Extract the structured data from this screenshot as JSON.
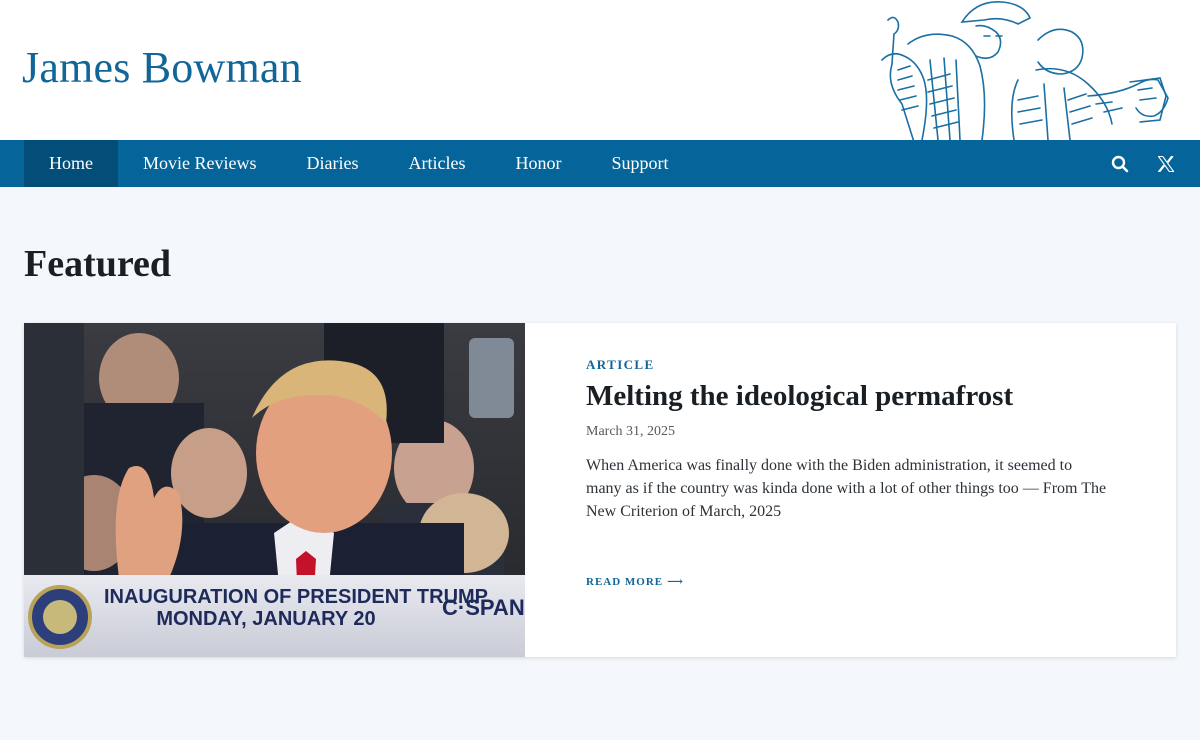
{
  "site": {
    "title": "James Bowman"
  },
  "nav": {
    "items": [
      {
        "label": "Home",
        "active": true
      },
      {
        "label": "Movie Reviews"
      },
      {
        "label": "Diaries"
      },
      {
        "label": "Articles"
      },
      {
        "label": "Honor"
      },
      {
        "label": "Support"
      }
    ],
    "icons": [
      "search-icon",
      "x-logo-icon"
    ]
  },
  "featured": {
    "heading": "Featured",
    "card": {
      "kicker": "ARTICLE",
      "title": "Melting the ideological permafrost",
      "date": "March 31, 2025",
      "excerpt": "When America was finally done with the Biden administration, it seemed to many as if the country was kinda done with a lot of other things too — From The New Criterion of March, 2025",
      "read_more": "READ MORE",
      "read_more_arrow": "⟶",
      "image": {
        "banner_line1": "INAUGURATION OF PRESIDENT TRUMP",
        "banner_line2": "MONDAY, JANUARY 20",
        "network": "C·SPAN"
      }
    }
  },
  "colors": {
    "brand": "#116699",
    "nav_bg": "#05659a",
    "nav_active": "#034d79",
    "page_bg": "#f4f7fb"
  }
}
